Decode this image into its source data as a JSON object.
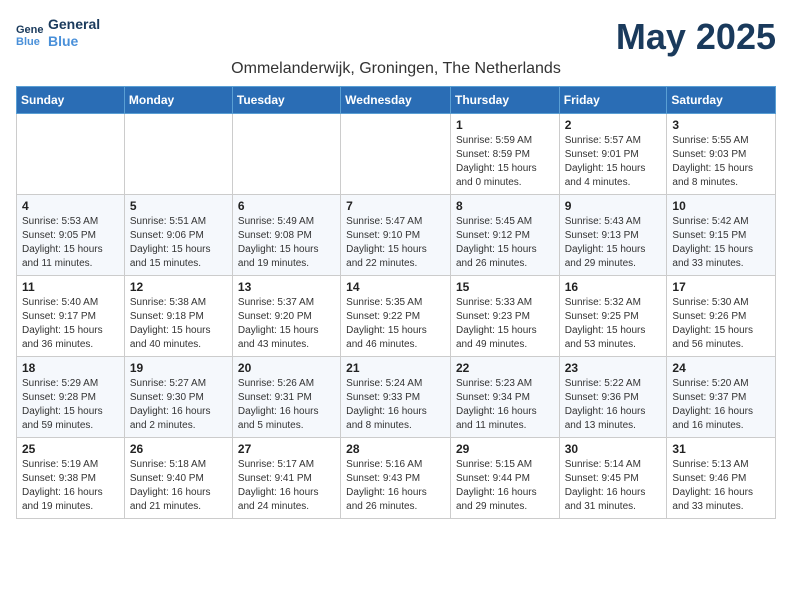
{
  "header": {
    "logo_line1": "General",
    "logo_line2": "Blue",
    "month_title": "May 2025",
    "subtitle": "Ommelanderwijk, Groningen, The Netherlands"
  },
  "weekdays": [
    "Sunday",
    "Monday",
    "Tuesday",
    "Wednesday",
    "Thursday",
    "Friday",
    "Saturday"
  ],
  "weeks": [
    [
      {
        "day": "",
        "info": ""
      },
      {
        "day": "",
        "info": ""
      },
      {
        "day": "",
        "info": ""
      },
      {
        "day": "",
        "info": ""
      },
      {
        "day": "1",
        "info": "Sunrise: 5:59 AM\nSunset: 8:59 PM\nDaylight: 15 hours\nand 0 minutes."
      },
      {
        "day": "2",
        "info": "Sunrise: 5:57 AM\nSunset: 9:01 PM\nDaylight: 15 hours\nand 4 minutes."
      },
      {
        "day": "3",
        "info": "Sunrise: 5:55 AM\nSunset: 9:03 PM\nDaylight: 15 hours\nand 8 minutes."
      }
    ],
    [
      {
        "day": "4",
        "info": "Sunrise: 5:53 AM\nSunset: 9:05 PM\nDaylight: 15 hours\nand 11 minutes."
      },
      {
        "day": "5",
        "info": "Sunrise: 5:51 AM\nSunset: 9:06 PM\nDaylight: 15 hours\nand 15 minutes."
      },
      {
        "day": "6",
        "info": "Sunrise: 5:49 AM\nSunset: 9:08 PM\nDaylight: 15 hours\nand 19 minutes."
      },
      {
        "day": "7",
        "info": "Sunrise: 5:47 AM\nSunset: 9:10 PM\nDaylight: 15 hours\nand 22 minutes."
      },
      {
        "day": "8",
        "info": "Sunrise: 5:45 AM\nSunset: 9:12 PM\nDaylight: 15 hours\nand 26 minutes."
      },
      {
        "day": "9",
        "info": "Sunrise: 5:43 AM\nSunset: 9:13 PM\nDaylight: 15 hours\nand 29 minutes."
      },
      {
        "day": "10",
        "info": "Sunrise: 5:42 AM\nSunset: 9:15 PM\nDaylight: 15 hours\nand 33 minutes."
      }
    ],
    [
      {
        "day": "11",
        "info": "Sunrise: 5:40 AM\nSunset: 9:17 PM\nDaylight: 15 hours\nand 36 minutes."
      },
      {
        "day": "12",
        "info": "Sunrise: 5:38 AM\nSunset: 9:18 PM\nDaylight: 15 hours\nand 40 minutes."
      },
      {
        "day": "13",
        "info": "Sunrise: 5:37 AM\nSunset: 9:20 PM\nDaylight: 15 hours\nand 43 minutes."
      },
      {
        "day": "14",
        "info": "Sunrise: 5:35 AM\nSunset: 9:22 PM\nDaylight: 15 hours\nand 46 minutes."
      },
      {
        "day": "15",
        "info": "Sunrise: 5:33 AM\nSunset: 9:23 PM\nDaylight: 15 hours\nand 49 minutes."
      },
      {
        "day": "16",
        "info": "Sunrise: 5:32 AM\nSunset: 9:25 PM\nDaylight: 15 hours\nand 53 minutes."
      },
      {
        "day": "17",
        "info": "Sunrise: 5:30 AM\nSunset: 9:26 PM\nDaylight: 15 hours\nand 56 minutes."
      }
    ],
    [
      {
        "day": "18",
        "info": "Sunrise: 5:29 AM\nSunset: 9:28 PM\nDaylight: 15 hours\nand 59 minutes."
      },
      {
        "day": "19",
        "info": "Sunrise: 5:27 AM\nSunset: 9:30 PM\nDaylight: 16 hours\nand 2 minutes."
      },
      {
        "day": "20",
        "info": "Sunrise: 5:26 AM\nSunset: 9:31 PM\nDaylight: 16 hours\nand 5 minutes."
      },
      {
        "day": "21",
        "info": "Sunrise: 5:24 AM\nSunset: 9:33 PM\nDaylight: 16 hours\nand 8 minutes."
      },
      {
        "day": "22",
        "info": "Sunrise: 5:23 AM\nSunset: 9:34 PM\nDaylight: 16 hours\nand 11 minutes."
      },
      {
        "day": "23",
        "info": "Sunrise: 5:22 AM\nSunset: 9:36 PM\nDaylight: 16 hours\nand 13 minutes."
      },
      {
        "day": "24",
        "info": "Sunrise: 5:20 AM\nSunset: 9:37 PM\nDaylight: 16 hours\nand 16 minutes."
      }
    ],
    [
      {
        "day": "25",
        "info": "Sunrise: 5:19 AM\nSunset: 9:38 PM\nDaylight: 16 hours\nand 19 minutes."
      },
      {
        "day": "26",
        "info": "Sunrise: 5:18 AM\nSunset: 9:40 PM\nDaylight: 16 hours\nand 21 minutes."
      },
      {
        "day": "27",
        "info": "Sunrise: 5:17 AM\nSunset: 9:41 PM\nDaylight: 16 hours\nand 24 minutes."
      },
      {
        "day": "28",
        "info": "Sunrise: 5:16 AM\nSunset: 9:43 PM\nDaylight: 16 hours\nand 26 minutes."
      },
      {
        "day": "29",
        "info": "Sunrise: 5:15 AM\nSunset: 9:44 PM\nDaylight: 16 hours\nand 29 minutes."
      },
      {
        "day": "30",
        "info": "Sunrise: 5:14 AM\nSunset: 9:45 PM\nDaylight: 16 hours\nand 31 minutes."
      },
      {
        "day": "31",
        "info": "Sunrise: 5:13 AM\nSunset: 9:46 PM\nDaylight: 16 hours\nand 33 minutes."
      }
    ]
  ]
}
